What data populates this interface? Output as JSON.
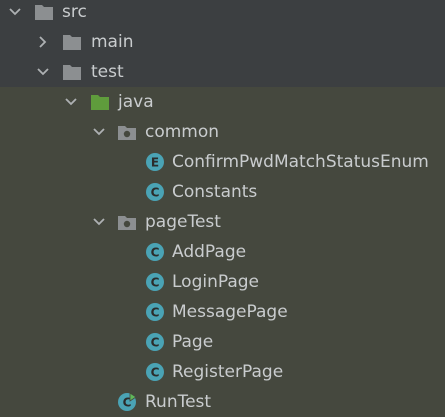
{
  "tree": {
    "src": "src",
    "main": "main",
    "test": "test",
    "java": "java",
    "common": "common",
    "confirm_enum": "ConfirmPwdMatchStatusEnum",
    "constants": "Constants",
    "page_test": "pageTest",
    "add_page": "AddPage",
    "login_page": "LoginPage",
    "message_page": "MessagePage",
    "page": "Page",
    "register_page": "RegisterPage",
    "run_test": "RunTest"
  },
  "icons": {
    "class_badge_letter": "C",
    "enum_badge_letter": "E"
  },
  "colors": {
    "background": "#3c3f41",
    "test_scope_background": "#45483e",
    "folder_gray": "#8c8f91",
    "folder_green": "#5f9c3c",
    "class_badge": "#4aa3b5",
    "text": "#c9ccce"
  }
}
